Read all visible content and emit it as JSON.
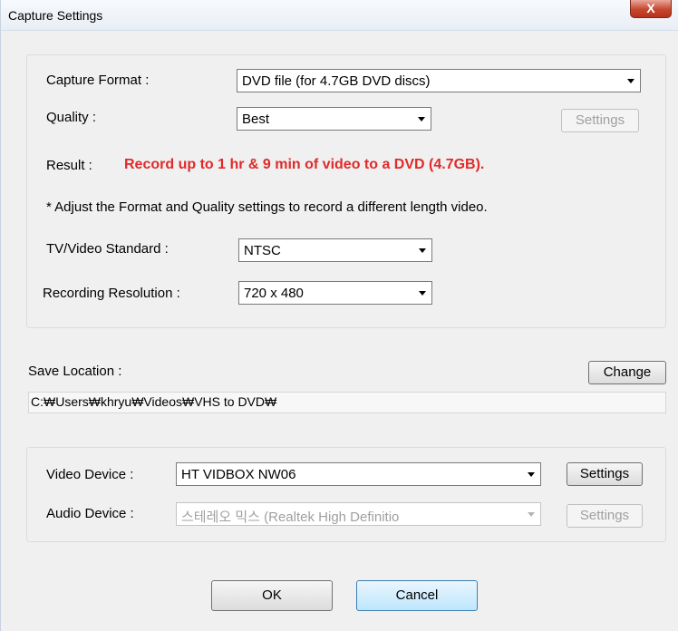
{
  "window": {
    "title": "Capture Settings",
    "close_label": "X"
  },
  "capture": {
    "format_label": "Capture Format :",
    "format_value": "DVD file (for 4.7GB DVD discs)",
    "quality_label": "Quality :",
    "quality_value": "Best",
    "quality_settings_label": "Settings",
    "result_label": "Result :",
    "result_value": "Record up to 1 hr & 9 min of  video to a DVD (4.7GB).",
    "note": "* Adjust the Format and Quality settings to record a different length video.",
    "standard_label": "TV/Video Standard :",
    "standard_value": "NTSC",
    "resolution_label": "Recording Resolution :",
    "resolution_value": "720 x 480"
  },
  "save": {
    "label": "Save Location :",
    "change_label": "Change",
    "path": "C:₩Users₩khryu₩Videos₩VHS to DVD₩"
  },
  "devices": {
    "video_label": "Video Device :",
    "video_value": "HT VIDBOX NW06",
    "video_settings_label": "Settings",
    "audio_label": "Audio Device :",
    "audio_value": "스테레오 믹스 (Realtek High Definitio",
    "audio_settings_label": "Settings"
  },
  "footer": {
    "ok_label": "OK",
    "cancel_label": "Cancel"
  }
}
